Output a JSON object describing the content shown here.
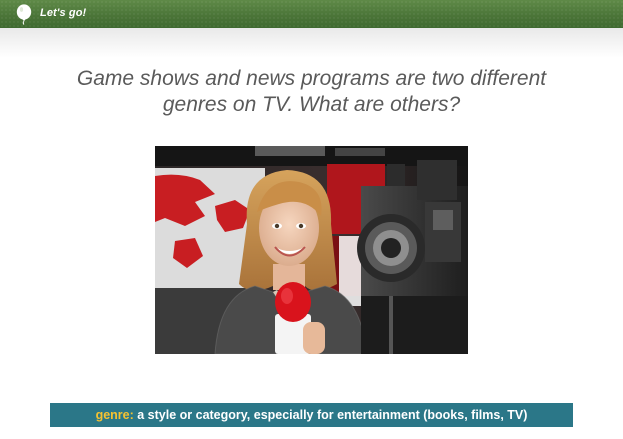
{
  "header": {
    "brand_label": "Let's go!",
    "brand_icon": "balloon-icon",
    "bar_color": "#4b7538"
  },
  "main": {
    "question": "Game shows and news programs are two different genres on TV. What are others?",
    "image_icon": "news-reporter-photo"
  },
  "definition": {
    "term": "genre:",
    "text": "a style or category, especially for entertainment (books, films, TV)",
    "bar_color": "#2b7788",
    "term_color": "#f6c231"
  }
}
